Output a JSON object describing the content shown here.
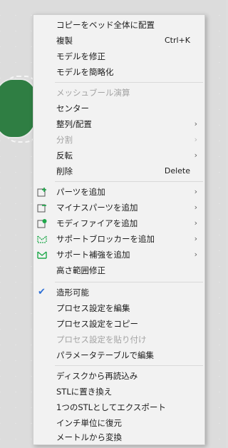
{
  "menu": {
    "items": [
      {
        "label": "コピーをベッド全体に配置"
      },
      {
        "label": "複製",
        "shortcut": "Ctrl+K"
      },
      {
        "label": "モデルを修正"
      },
      {
        "label": "モデルを簡略化"
      },
      {
        "label": "メッシュブール演算"
      },
      {
        "label": "センター"
      },
      {
        "label": "整列/配置",
        "arrow": "›"
      },
      {
        "label": "分割",
        "arrow": "›"
      },
      {
        "label": "反転",
        "arrow": "›"
      },
      {
        "label": "削除",
        "shortcut": "Delete"
      },
      {
        "label": "パーツを追加",
        "arrow": "›"
      },
      {
        "label": "マイナスパーツを追加",
        "arrow": "›"
      },
      {
        "label": "モディファイアを追加",
        "arrow": "›"
      },
      {
        "label": "サポートブロッカーを追加",
        "arrow": "›"
      },
      {
        "label": "サポート補強を追加",
        "arrow": "›"
      },
      {
        "label": "高さ範囲修正"
      },
      {
        "label": "造形可能",
        "check": "✔"
      },
      {
        "label": "プロセス設定を編集"
      },
      {
        "label": "プロセス設定をコピー"
      },
      {
        "label": "プロセス設定を貼り付け"
      },
      {
        "label": "パラメータテーブルで編集"
      },
      {
        "label": "ディスクから再読込み"
      },
      {
        "label": "STLに置き換え"
      },
      {
        "label": "1つのSTLとしてエクスポート"
      },
      {
        "label": "インチ単位に復元"
      },
      {
        "label": "メートルから変換"
      }
    ]
  },
  "colors": {
    "accent_green": "#1ea84a",
    "check_blue": "#2d6fd6",
    "model_green": "#2f7e43"
  }
}
